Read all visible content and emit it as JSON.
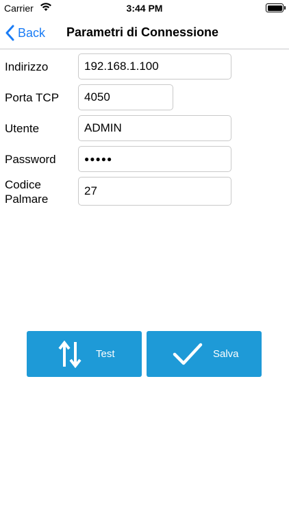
{
  "status_bar": {
    "carrier": "Carrier",
    "time": "3:44 PM"
  },
  "nav": {
    "back_label": "Back",
    "title": "Parametri di Connessione"
  },
  "form": {
    "indirizzo": {
      "label": "Indirizzo",
      "value": "192.168.1.100"
    },
    "porta": {
      "label": "Porta TCP",
      "value": "4050"
    },
    "utente": {
      "label": "Utente",
      "value": "ADMIN"
    },
    "password": {
      "label": "Password",
      "value": "●●●●●"
    },
    "codice": {
      "label_line1": "Codice",
      "label_line2": "Palmare",
      "value": "27"
    }
  },
  "actions": {
    "test_label": "Test",
    "salva_label": "Salva"
  },
  "colors": {
    "accent": "#1a7cf5",
    "button_bg": "#1e9ad7"
  }
}
